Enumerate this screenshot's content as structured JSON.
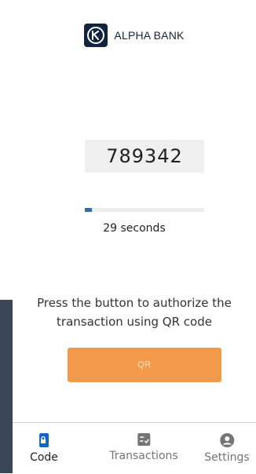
{
  "brand": {
    "name": "ALPHA BANK",
    "logo_icon": "alpha-bank-logo",
    "color": "#12233f"
  },
  "code": {
    "value": "789342"
  },
  "timer": {
    "progress": 0.06,
    "label": "29 seconds",
    "color": "#2a6fb4"
  },
  "instruction": {
    "text": "Press the button to authorize the transaction using QR code"
  },
  "qr_button": {
    "label": "QR",
    "color": "#f2994a"
  },
  "nav": {
    "items": [
      {
        "label": "Code",
        "icon": "phone-lock-icon",
        "active": true
      },
      {
        "label": "Transactions",
        "icon": "checklist-icon",
        "active": false
      },
      {
        "label": "Settings",
        "icon": "user-circle-icon",
        "active": false
      }
    ]
  }
}
